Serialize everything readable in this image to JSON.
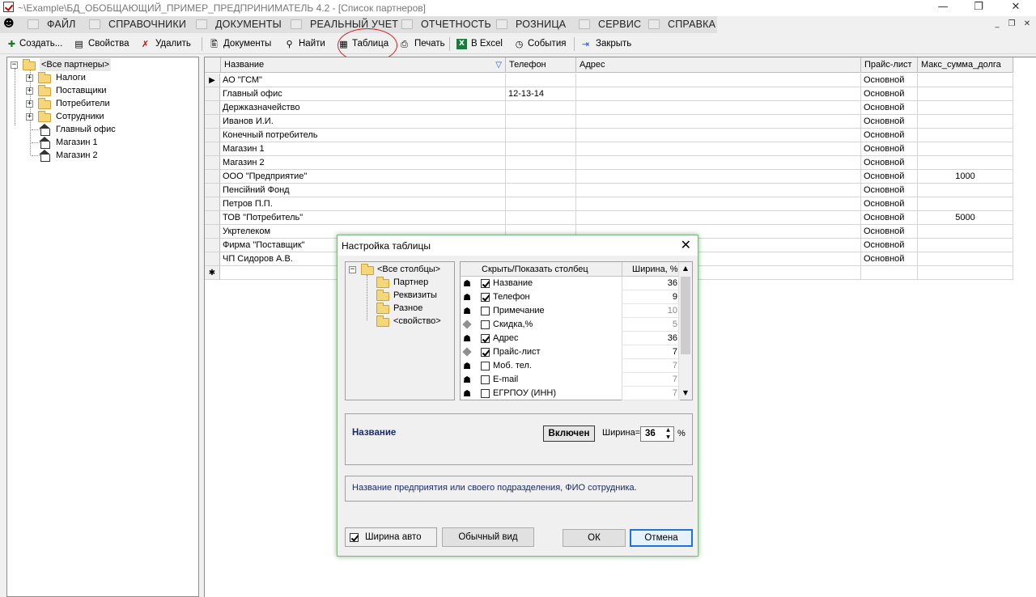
{
  "window": {
    "title": "~\\Example\\БД_ОБОБЩАЮЩИЙ_ПРИМЕР_ПРЕДПРИНИМАТЕЛЬ 4.2 - [Список партнеров]",
    "minimize": "—",
    "restore": "❐",
    "close": "✕"
  },
  "menu": {
    "items": [
      "ФАЙЛ",
      "СПРАВОЧНИКИ",
      "ДОКУМЕНТЫ",
      "РЕАЛЬНЫЙ УЧЕТ",
      "ОТЧЕТНОСТЬ",
      "РОЗНИЦА",
      "СЕРВИС",
      "СПРАВКА"
    ],
    "mdi_min": "_",
    "mdi_restore": "❐",
    "mdi_close": "✕"
  },
  "toolbar": {
    "create": "Создать...",
    "properties": "Свойства",
    "delete": "Удалить",
    "documents": "Документы",
    "find": "Найти",
    "table": "Таблица",
    "print": "Печать",
    "excel": "В Excel",
    "events": "События",
    "close": "Закрыть"
  },
  "tree": {
    "root": "<Все партнеры>",
    "folders": [
      "Налоги",
      "Поставщики",
      "Потребители",
      "Сотрудники"
    ],
    "places": [
      "Главный офис",
      "Магазин 1",
      "Магазин 2"
    ]
  },
  "grid": {
    "columns": {
      "name": "Название",
      "phone": "Телефон",
      "address": "Адрес",
      "pricelist": "Прайс-лист",
      "maxdebt": "Макс_сумма_долга"
    },
    "current_row_marker": "▶",
    "new_row_marker": "✱",
    "rows": [
      {
        "name": "АО \"ГСМ\"",
        "phone": "",
        "address": "",
        "pricelist": "Основной",
        "maxdebt": ""
      },
      {
        "name": "Главный офис",
        "phone": "12-13-14",
        "address": "",
        "pricelist": "Основной",
        "maxdebt": ""
      },
      {
        "name": "Держказначейство",
        "phone": "",
        "address": "",
        "pricelist": "Основной",
        "maxdebt": ""
      },
      {
        "name": "Иванов И.И.",
        "phone": "",
        "address": "",
        "pricelist": "Основной",
        "maxdebt": ""
      },
      {
        "name": "Конечный потребитель",
        "phone": "",
        "address": "",
        "pricelist": "Основной",
        "maxdebt": ""
      },
      {
        "name": "Магазин 1",
        "phone": "",
        "address": "",
        "pricelist": "Основной",
        "maxdebt": ""
      },
      {
        "name": "Магазин 2",
        "phone": "",
        "address": "",
        "pricelist": "Основной",
        "maxdebt": ""
      },
      {
        "name": "ООО \"Предприятие\"",
        "phone": "",
        "address": "",
        "pricelist": "Основной",
        "maxdebt": "1000"
      },
      {
        "name": "Пенсійний Фонд",
        "phone": "",
        "address": "",
        "pricelist": "Основной",
        "maxdebt": ""
      },
      {
        "name": "Петров П.П.",
        "phone": "",
        "address": "",
        "pricelist": "Основной",
        "maxdebt": ""
      },
      {
        "name": "ТОВ \"Потребитель\"",
        "phone": "",
        "address": "",
        "pricelist": "Основной",
        "maxdebt": "5000"
      },
      {
        "name": "Укртелеком",
        "phone": "",
        "address": "",
        "pricelist": "Основной",
        "maxdebt": ""
      },
      {
        "name": "Фирма \"Поставщик\"",
        "phone": "",
        "address": "",
        "pricelist": "Основной",
        "maxdebt": ""
      },
      {
        "name": "ЧП Сидоров А.В.",
        "phone": "",
        "address": "",
        "pricelist": "Основной",
        "maxdebt": ""
      }
    ]
  },
  "dialog": {
    "title": "Настройка таблицы",
    "close": "✕",
    "col_tree": {
      "root": "<Все столбцы>",
      "items": [
        "Партнер",
        "Реквизиты",
        "Разное",
        "<свойство>"
      ]
    },
    "list_header": {
      "show_hide": "Скрыть/Показать столбец",
      "width": "Ширина, %"
    },
    "columns": [
      {
        "icon": "person-icon",
        "checked": true,
        "name": "Название",
        "width": "36",
        "dim": false
      },
      {
        "icon": "person-icon",
        "checked": true,
        "name": "Телефон",
        "width": "9",
        "dim": false
      },
      {
        "icon": "person-icon",
        "checked": false,
        "name": "Примечание",
        "width": "10",
        "dim": true
      },
      {
        "icon": "diamond-icon",
        "checked": false,
        "name": "Скидка,%",
        "width": "5",
        "dim": true
      },
      {
        "icon": "person-icon",
        "checked": true,
        "name": "Адрес",
        "width": "36",
        "dim": false
      },
      {
        "icon": "diamond-icon",
        "checked": true,
        "name": "Прайс-лист",
        "width": "7",
        "dim": false
      },
      {
        "icon": "person-icon",
        "checked": false,
        "name": "Моб. тел.",
        "width": "7",
        "dim": true
      },
      {
        "icon": "person-icon",
        "checked": false,
        "name": "E-mail",
        "width": "7",
        "dim": true
      },
      {
        "icon": "person-icon",
        "checked": false,
        "name": "ЕГРПОУ (ИНН)",
        "width": "7",
        "dim": true
      }
    ],
    "selected_name": "Название",
    "enabled_label": "Включен",
    "width_label": "Ширина=",
    "width_value": "36",
    "percent": "%",
    "description": "Название предприятия или своего подразделения, ФИО сотрудника.",
    "auto_width": "Ширина авто",
    "auto_width_checked": true,
    "normal_view": "Обычный вид",
    "ok": "ОК",
    "cancel": "Отмена",
    "scroll_up": "▲",
    "scroll_down": "▼",
    "spin_up": "▲",
    "spin_down": "▼"
  }
}
